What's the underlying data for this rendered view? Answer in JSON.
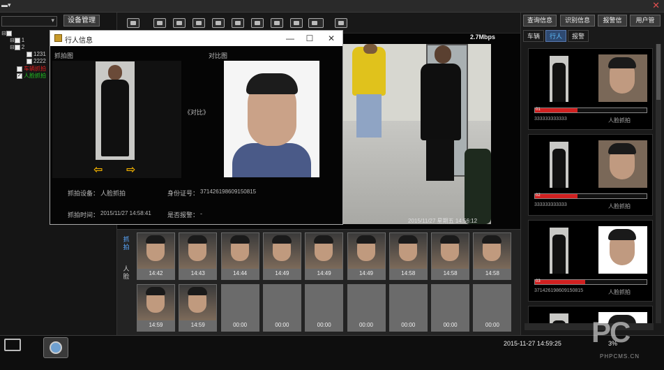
{
  "titlebar": {
    "menu_icon": "menu-icon",
    "close_icon": "close-icon"
  },
  "left_panel": {
    "device_manage_label": "设备管理",
    "tree": [
      {
        "label": "",
        "level": 0
      },
      {
        "label": "1",
        "level": 1
      },
      {
        "label": "2",
        "level": 1
      },
      {
        "label": "1231",
        "level": 2
      },
      {
        "label": "2222",
        "level": 2
      },
      {
        "label": "车辆抓拍",
        "level": 1,
        "color": "#e02020"
      },
      {
        "label": "人脸抓拍",
        "level": 1,
        "color": "#22c022",
        "checked": true
      }
    ]
  },
  "toolbar": {
    "icons": [
      "layout-icon",
      "camera-icon",
      "camera-off-icon",
      "snapshot-icon",
      "record-icon",
      "playback-icon",
      "map-icon",
      "window-icon",
      "monitor-icon",
      "keyboard-icon",
      "fullscreen-icon"
    ]
  },
  "video": {
    "bitrate": "2.7Mbps",
    "timestamp": "2015/11/27 星期五 14:56:12"
  },
  "popup": {
    "title": "行人信息",
    "capture_label": "抓拍图",
    "compare_label": "对比图",
    "compare_center": "《对比》",
    "capture_device_label": "抓拍设备：",
    "capture_device_value": "人脸抓拍",
    "id_label": "身份证号：",
    "id_value": "371426198609150815",
    "capture_time_label": "抓拍时间：",
    "capture_time_value": "2015/11/27 14:58:41",
    "alarm_label": "是否报警：",
    "alarm_value": "-",
    "btn_min": "—",
    "btn_max": "☐",
    "btn_close": "✕"
  },
  "strip": {
    "tabs": [
      "抓拍",
      "人脸"
    ],
    "thumbs": [
      "14:42",
      "14:43",
      "14:44",
      "14:49",
      "14:49",
      "14:49",
      "14:58",
      "14:58",
      "14:58",
      "14:59",
      "14:59",
      "00:00",
      "00:00",
      "00:00",
      "00:00",
      "00:00",
      "00:00",
      "00:00"
    ],
    "empty_from": 11
  },
  "right_panel": {
    "buttons": [
      "查询信息",
      "识别信息",
      "报警信",
      "用户管"
    ],
    "tabs": [
      "车辆",
      "行人",
      "报警"
    ],
    "active_tab": 1,
    "cards": [
      {
        "num": "01",
        "id": "333333333333",
        "type": "人脸抓拍",
        "score": 0.38,
        "idphoto": false
      },
      {
        "num": "02",
        "id": "333333333333",
        "type": "人脸抓拍",
        "score": 0.38,
        "idphoto": false
      },
      {
        "num": "03",
        "id": "371426198609150815",
        "type": "人脸抓拍",
        "score": 0.45,
        "idphoto": true
      },
      {
        "num": "",
        "id": "",
        "type": "",
        "score": 0,
        "idphoto": true
      }
    ]
  },
  "statusbar": {
    "datetime": "2015-11-27 14:59:25",
    "cpu": "3%",
    "icons": [
      "monitor-icon",
      "camera-lens-icon"
    ]
  },
  "watermark": {
    "big": "PC",
    "small": "PHPCMS.CN"
  }
}
